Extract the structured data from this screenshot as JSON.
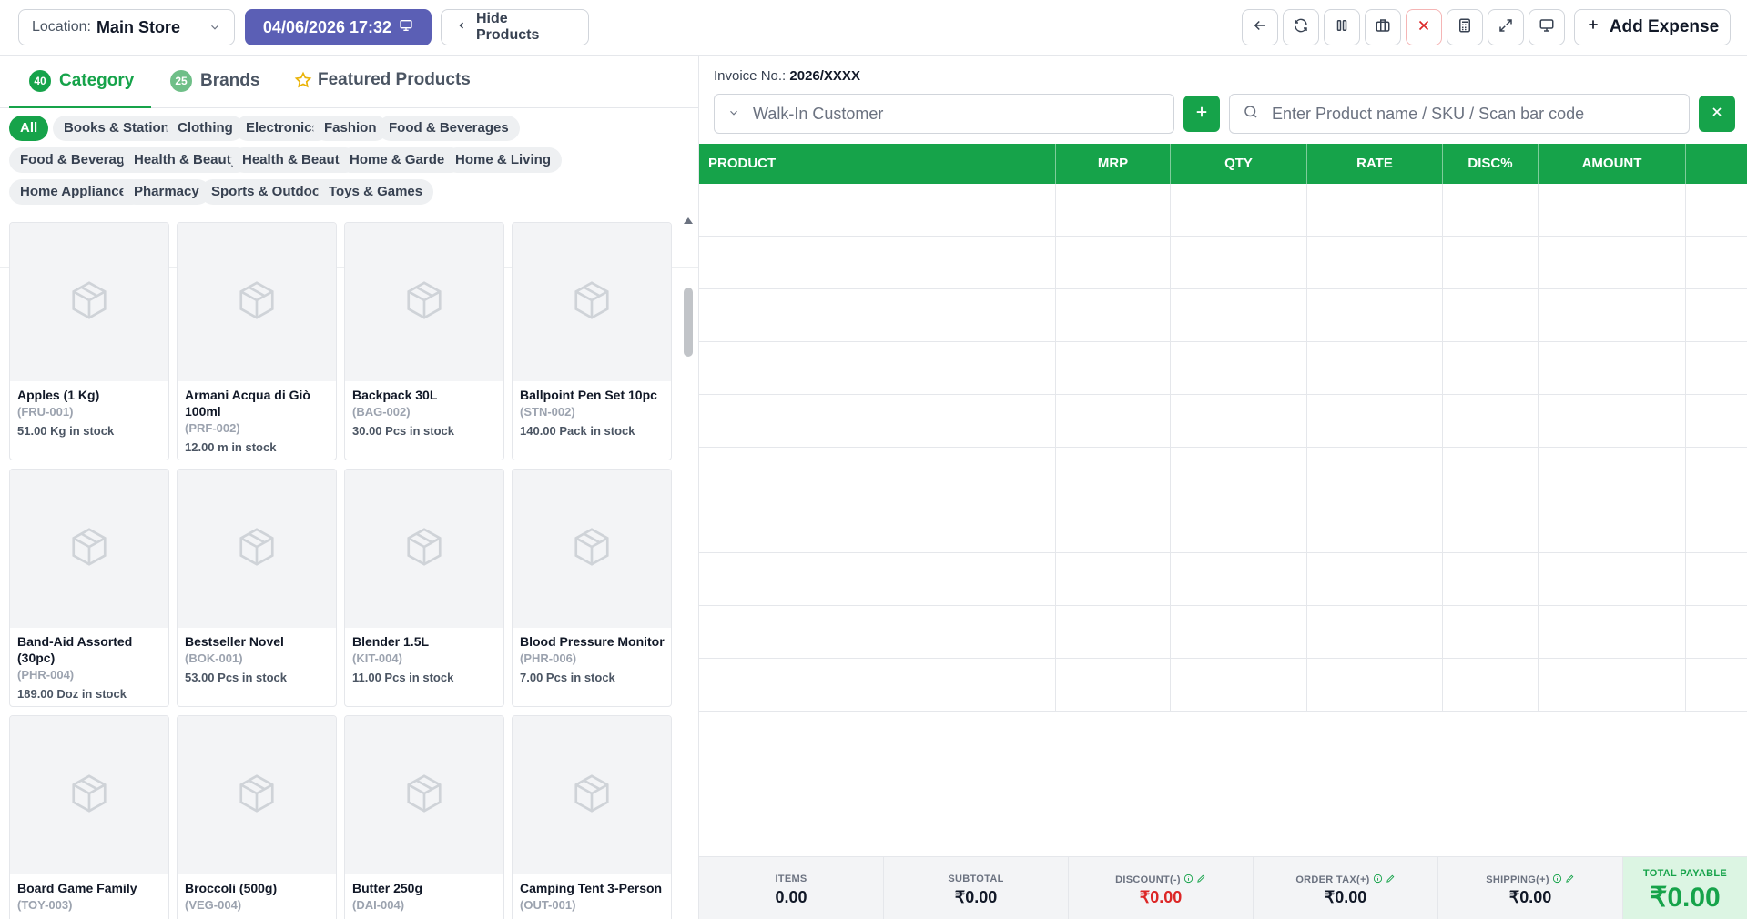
{
  "topbar": {
    "location_label": "Location:",
    "location_value": "Main Store",
    "datetime": "04/06/2026 17:32",
    "hide_products": "Hide Products",
    "add_expense": "Add Expense"
  },
  "tabs": {
    "category_count": "40",
    "category": "Category",
    "brands_count": "25",
    "brands": "Brands",
    "featured": "Featured Products"
  },
  "chips": [
    "All",
    "Books & Stationery",
    "Clothing",
    "Electronics",
    "Fashion",
    "Food & Beverages",
    "Food & Beverages",
    "Health & Beauty",
    "Health & Beauty",
    "Home & Garden",
    "Home & Living",
    "Home Appliances",
    "Pharmacy",
    "Sports & Outdoors",
    "Toys & Games"
  ],
  "products": [
    {
      "name": "Apples (1 Kg)",
      "sku": "(FRU-001)",
      "stock": "51.00 Kg in stock"
    },
    {
      "name": "Armani Acqua di Giò 100ml",
      "sku": "(PRF-002)",
      "stock": "12.00 m in stock"
    },
    {
      "name": "Backpack 30L",
      "sku": "(BAG-002)",
      "stock": "30.00 Pcs in stock"
    },
    {
      "name": "Ballpoint Pen Set 10pc",
      "sku": "(STN-002)",
      "stock": "140.00 Pack in stock"
    },
    {
      "name": "Band-Aid Assorted (30pc)",
      "sku": "(PHR-004)",
      "stock": "189.00 Doz in stock"
    },
    {
      "name": "Bestseller Novel",
      "sku": "(BOK-001)",
      "stock": "53.00 Pcs in stock"
    },
    {
      "name": "Blender 1.5L",
      "sku": "(KIT-004)",
      "stock": "11.00 Pcs in stock"
    },
    {
      "name": "Blood Pressure Monitor",
      "sku": "(PHR-006)",
      "stock": "7.00 Pcs in stock"
    },
    {
      "name": "Board Game Family",
      "sku": "(TOY-003)",
      "stock": ""
    },
    {
      "name": "Broccoli (500g)",
      "sku": "(VEG-004)",
      "stock": ""
    },
    {
      "name": "Butter 250g",
      "sku": "(DAI-004)",
      "stock": ""
    },
    {
      "name": "Camping Tent 3-Person",
      "sku": "(OUT-001)",
      "stock": ""
    }
  ],
  "invoice": {
    "label": "Invoice No.:",
    "number": "2026/XXXX"
  },
  "customer_placeholder": "Walk-In Customer",
  "search_placeholder": "Enter Product name / SKU / Scan bar code",
  "table_headers": [
    "PRODUCT",
    "MRP",
    "QTY",
    "RATE",
    "DISC%",
    "AMOUNT"
  ],
  "footer": {
    "items_label": "ITEMS",
    "items_value": "0.00",
    "subtotal_label": "SUBTOTAL",
    "subtotal_value": "₹0.00",
    "discount_label": "DISCOUNT(-)",
    "discount_value": "₹0.00",
    "tax_label": "ORDER TAX(+)",
    "tax_value": "₹0.00",
    "shipping_label": "SHIPPING(+)",
    "shipping_value": "₹0.00",
    "total_label": "TOTAL PAYABLE",
    "total_value": "₹0.00"
  },
  "colors": {
    "accent": "#16a34a",
    "datetime_bg": "#5b5fb5",
    "discount": "#dc2626"
  },
  "icons": [
    "back-icon",
    "refresh-icon",
    "pause-icon",
    "briefcase-icon",
    "close-icon",
    "calculator-icon",
    "fullscreen-icon",
    "monitor-icon"
  ]
}
